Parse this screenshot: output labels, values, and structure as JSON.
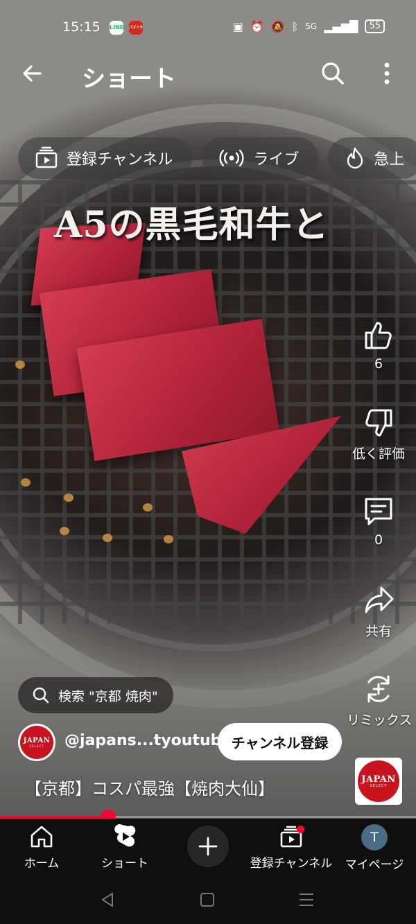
{
  "status_bar": {
    "time": "15:15",
    "battery": "55",
    "line_badge": "LINE",
    "app_badge": "パズドラ",
    "network": "5G"
  },
  "header": {
    "title": "ショート"
  },
  "chips": [
    {
      "label": "登録チャンネル",
      "icon": "subscriptions-icon"
    },
    {
      "label": "ライブ",
      "icon": "live-icon"
    },
    {
      "label": "急上",
      "icon": "trending-icon"
    }
  ],
  "video": {
    "overlay_text": "A5の黒毛和牛と",
    "progress": 0.26
  },
  "actions": {
    "like_count": "6",
    "dislike_label": "低く評価",
    "comment_count": "0",
    "share_label": "共有",
    "remix_label": "リミックス"
  },
  "search_suggestion": "検索 \"京都 焼肉\"",
  "channel": {
    "handle": "@japans...tyoutube",
    "subscribe_label": "チャンネル登録",
    "logo_text": "JAPAN",
    "logo_sub": "SELECT"
  },
  "video_title": "【京都】コスパ最強【焼肉大仙】",
  "bottom_nav": [
    {
      "label": "ホーム",
      "icon": "home-icon"
    },
    {
      "label": "ショート",
      "icon": "shorts-icon"
    },
    {
      "label": "",
      "icon": "create-icon"
    },
    {
      "label": "登録チャンネル",
      "icon": "subscriptions-icon"
    },
    {
      "label": "マイページ",
      "icon": "avatar"
    }
  ],
  "user_initial": "T",
  "colors": {
    "accent": "#ff0033",
    "nav_background": "#0f0f0f",
    "logo_red": "#c8141e"
  }
}
